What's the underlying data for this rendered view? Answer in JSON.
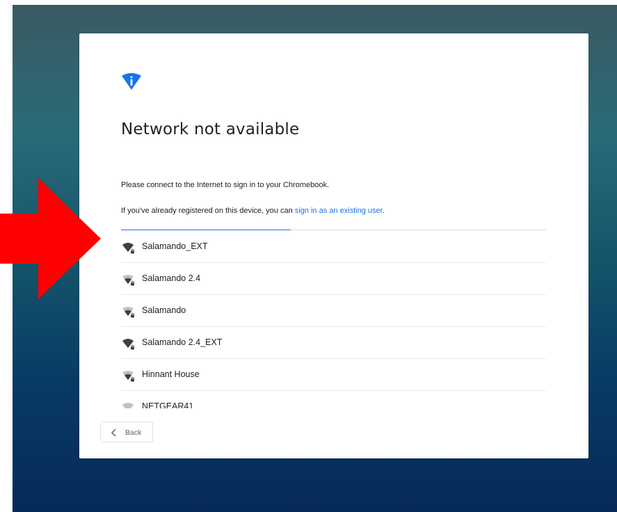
{
  "screen": {
    "icon": "wifi-info-icon",
    "title": "Network not available",
    "description": "Please connect to the Internet to sign in to your Chromebook.",
    "existing_user_prefix": "If you've already registered on this device, you can ",
    "existing_user_link": "sign in as an existing user",
    "existing_user_suffix": ".",
    "progress_fraction": 0.4
  },
  "networks": [
    {
      "name": "Salamando_EXT",
      "icon": "wifi-secured-icon",
      "signal": "strong"
    },
    {
      "name": "Salamando 2.4",
      "icon": "wifi-secured-icon",
      "signal": "medium"
    },
    {
      "name": "Salamando",
      "icon": "wifi-secured-icon",
      "signal": "medium"
    },
    {
      "name": "Salamando 2.4_EXT",
      "icon": "wifi-secured-icon",
      "signal": "strong"
    },
    {
      "name": "Hinnant House",
      "icon": "wifi-secured-icon",
      "signal": "medium"
    },
    {
      "name": "NETGEAR41",
      "icon": "wifi-icon",
      "signal": "weak"
    }
  ],
  "footer": {
    "back_label": "Back",
    "back_icon": "chevron-left-icon"
  },
  "annotation": {
    "arrow_color": "#ff0000",
    "arrow_icon": "red-arrow-icon"
  },
  "colors": {
    "accent": "#1a73e8",
    "text": "#202124",
    "icon_dark": "#3c4043",
    "icon_light": "#bdc1c6"
  }
}
